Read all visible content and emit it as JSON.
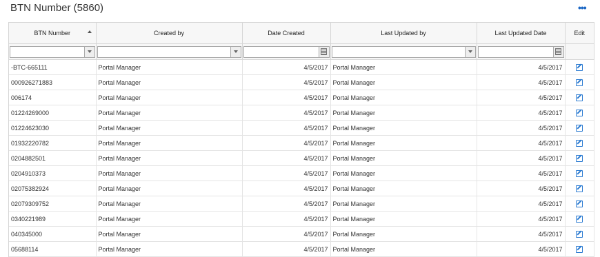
{
  "title": "BTN Number (5860)",
  "more_label": "•••",
  "columns": [
    "BTN Number",
    "Created by",
    "Date Created",
    "Last Updated by",
    "Last Updated Date",
    "Edit"
  ],
  "rows": [
    [
      "-BTC-665111",
      "Portal Manager",
      "4/5/2017",
      "Portal Manager",
      "4/5/2017"
    ],
    [
      "000926271883",
      "Portal Manager",
      "4/5/2017",
      "Portal Manager",
      "4/5/2017"
    ],
    [
      "006174",
      "Portal Manager",
      "4/5/2017",
      "Portal Manager",
      "4/5/2017"
    ],
    [
      "01224269000",
      "Portal Manager",
      "4/5/2017",
      "Portal Manager",
      "4/5/2017"
    ],
    [
      "01224623030",
      "Portal Manager",
      "4/5/2017",
      "Portal Manager",
      "4/5/2017"
    ],
    [
      "01932220782",
      "Portal Manager",
      "4/5/2017",
      "Portal Manager",
      "4/5/2017"
    ],
    [
      "0204882501",
      "Portal Manager",
      "4/5/2017",
      "Portal Manager",
      "4/5/2017"
    ],
    [
      "0204910373",
      "Portal Manager",
      "4/5/2017",
      "Portal Manager",
      "4/5/2017"
    ],
    [
      "02075382924",
      "Portal Manager",
      "4/5/2017",
      "Portal Manager",
      "4/5/2017"
    ],
    [
      "02079309752",
      "Portal Manager",
      "4/5/2017",
      "Portal Manager",
      "4/5/2017"
    ],
    [
      "0340221989",
      "Portal Manager",
      "4/5/2017",
      "Portal Manager",
      "4/5/2017"
    ],
    [
      "040345000",
      "Portal Manager",
      "4/5/2017",
      "Portal Manager",
      "4/5/2017"
    ],
    [
      "05688114",
      "Portal Manager",
      "4/5/2017",
      "Portal Manager",
      "4/5/2017"
    ]
  ],
  "accent_color": "#1a66c4"
}
